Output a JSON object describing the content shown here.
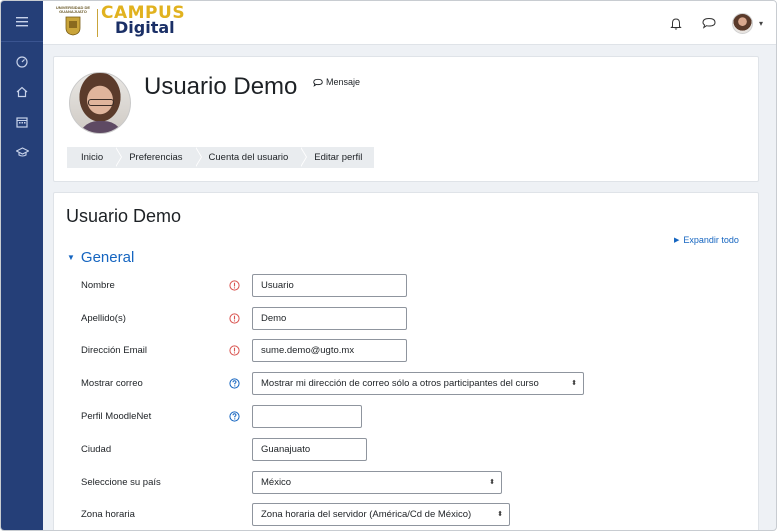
{
  "header": {
    "seal_text": "UNIVERSIDAD DE GUANAJUATO",
    "brand_line1": "CAMPUS",
    "brand_line2": "Digital"
  },
  "colors": {
    "rail": "#253f78",
    "accent": "#1565c0",
    "brand_gold": "#e1b21f",
    "brand_navy": "#1a2f66",
    "required": "#d9534f"
  },
  "rail_icons": [
    "menu-icon",
    "dashboard-icon",
    "home-icon",
    "calendar-icon",
    "courses-icon"
  ],
  "profile": {
    "full_name": "Usuario Demo",
    "message_label": "Mensaje"
  },
  "breadcrumb": [
    "Inicio",
    "Preferencias",
    "Cuenta del usuario",
    "Editar perfil"
  ],
  "form": {
    "page_title": "Usuario Demo",
    "expand_all": "Expandir todo",
    "section_title": "General",
    "fields": [
      {
        "label": "Nombre",
        "value": "Usuario",
        "icon": "required-icon"
      },
      {
        "label": "Apellido(s)",
        "value": "Demo",
        "icon": "required-icon"
      },
      {
        "label": "Dirección Email",
        "value": "sume.demo@ugto.mx",
        "icon": "required-icon"
      },
      {
        "label": "Mostrar correo",
        "value": "Mostrar mi dirección de correo sólo a otros participantes del curso",
        "icon": "help-icon"
      },
      {
        "label": "Perfil MoodleNet",
        "value": "",
        "icon": "help-icon"
      },
      {
        "label": "Ciudad",
        "value": "Guanajuato",
        "icon": ""
      },
      {
        "label": "Seleccione su país",
        "value": "México",
        "icon": ""
      },
      {
        "label": "Zona horaria",
        "value": "Zona horaria del servidor (América/Cd de México)",
        "icon": ""
      }
    ]
  }
}
